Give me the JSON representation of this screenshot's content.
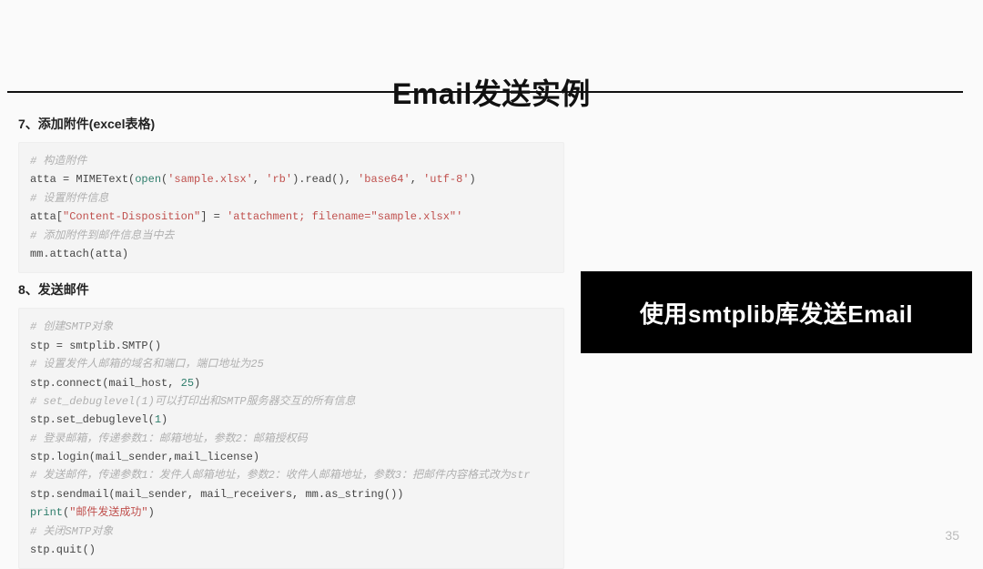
{
  "slide": {
    "title": "Email发送实例",
    "page_number": "35"
  },
  "callout": {
    "text": "使用smtplib库发送Email"
  },
  "section7": {
    "heading": "7、添加附件(excel表格)",
    "code": {
      "c1": "# 构造附件",
      "l1a": "atta = MIMEText(",
      "l1_fn": "open",
      "l1b": "(",
      "l1_s1": "'sample.xlsx'",
      "l1c": ", ",
      "l1_s2": "'rb'",
      "l1d": ").read(), ",
      "l1_s3": "'base64'",
      "l1e": ", ",
      "l1_s4": "'utf-8'",
      "l1f": ")",
      "c2": "# 设置附件信息",
      "l2a": "atta[",
      "l2_s1": "\"Content-Disposition\"",
      "l2b": "] = ",
      "l2_s2": "'attachment; filename=\"sample.xlsx\"'",
      "c3": "# 添加附件到邮件信息当中去",
      "l3": "mm.attach(atta)"
    }
  },
  "section8": {
    "heading": "8、发送邮件",
    "code": {
      "c1": "# 创建SMTP对象",
      "l1": "stp = smtplib.SMTP()",
      "c2": "# 设置发件人邮箱的域名和端口，端口地址为25",
      "l2a": "stp.connect(mail_host, ",
      "l2_num": "25",
      "l2b": ")",
      "c3": "# set_debuglevel(1)可以打印出和SMTP服务器交互的所有信息",
      "l3a": "stp.set_debuglevel(",
      "l3_num": "1",
      "l3b": ")",
      "c4": "# 登录邮箱，传递参数1：邮箱地址，参数2：邮箱授权码",
      "l4": "stp.login(mail_sender,mail_license)",
      "c5": "# 发送邮件，传递参数1：发件人邮箱地址，参数2：收件人邮箱地址，参数3：把邮件内容格式改为str",
      "l5": "stp.sendmail(mail_sender, mail_receivers, mm.as_string())",
      "l6a_fn": "print",
      "l6b": "(",
      "l6_s1": "\"邮件发送成功\"",
      "l6c": ")",
      "c6": "# 关闭SMTP对象",
      "l7": "stp.quit()"
    }
  }
}
